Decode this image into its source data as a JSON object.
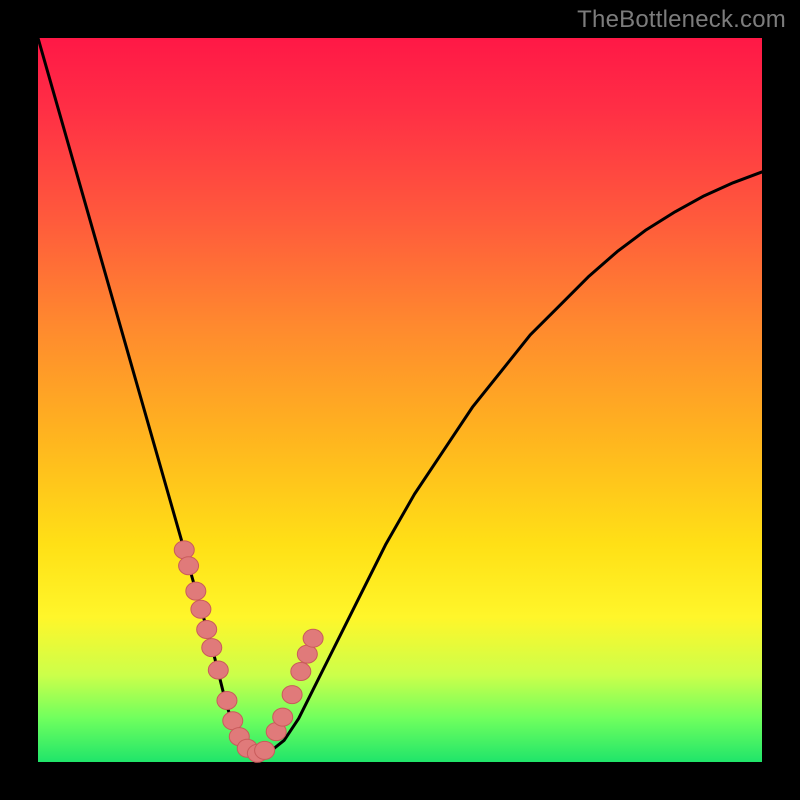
{
  "watermark": "TheBottleneck.com",
  "colors": {
    "background": "#000000",
    "gradient_top": "#ff1846",
    "gradient_mid1": "#ff8a2e",
    "gradient_mid2": "#ffe016",
    "gradient_bottom": "#20e56a",
    "curve": "#000000",
    "marker_fill": "#e07a7a",
    "marker_stroke": "#c95b5b",
    "watermark_text": "#7c7c7c"
  },
  "chart_data": {
    "type": "line",
    "title": "",
    "xlabel": "",
    "ylabel": "",
    "xlim": [
      0,
      100
    ],
    "ylim": [
      0,
      100
    ],
    "grid": false,
    "legend": false,
    "series": [
      {
        "name": "bottleneck-curve",
        "x": [
          0,
          2,
          4,
          6,
          8,
          10,
          12,
          14,
          16,
          18,
          20,
          22,
          24,
          25,
          26,
          27,
          28,
          29,
          30,
          31,
          32,
          34,
          36,
          38,
          40,
          44,
          48,
          52,
          56,
          60,
          64,
          68,
          72,
          76,
          80,
          84,
          88,
          92,
          96,
          100
        ],
        "y": [
          100,
          93,
          86,
          79,
          72,
          65,
          58,
          51,
          44,
          37,
          30,
          23,
          16,
          12,
          8,
          5,
          3,
          2,
          1.2,
          1,
          1.4,
          3,
          6,
          10,
          14,
          22,
          30,
          37,
          43,
          49,
          54,
          59,
          63,
          67,
          70.5,
          73.5,
          76,
          78.2,
          80,
          81.5
        ]
      }
    ],
    "markers": {
      "name": "highlighted-points",
      "x": [
        20.2,
        20.8,
        21.8,
        22.5,
        23.3,
        24.0,
        24.9,
        26.1,
        26.9,
        27.8,
        28.9,
        30.3,
        31.3,
        32.9,
        33.8,
        35.1,
        36.3,
        37.2,
        38.0
      ],
      "y": [
        29.3,
        27.1,
        23.6,
        21.1,
        18.3,
        15.8,
        12.7,
        8.5,
        5.7,
        3.5,
        1.9,
        1.2,
        1.6,
        4.2,
        6.2,
        9.3,
        12.5,
        14.9,
        17.1
      ]
    }
  }
}
